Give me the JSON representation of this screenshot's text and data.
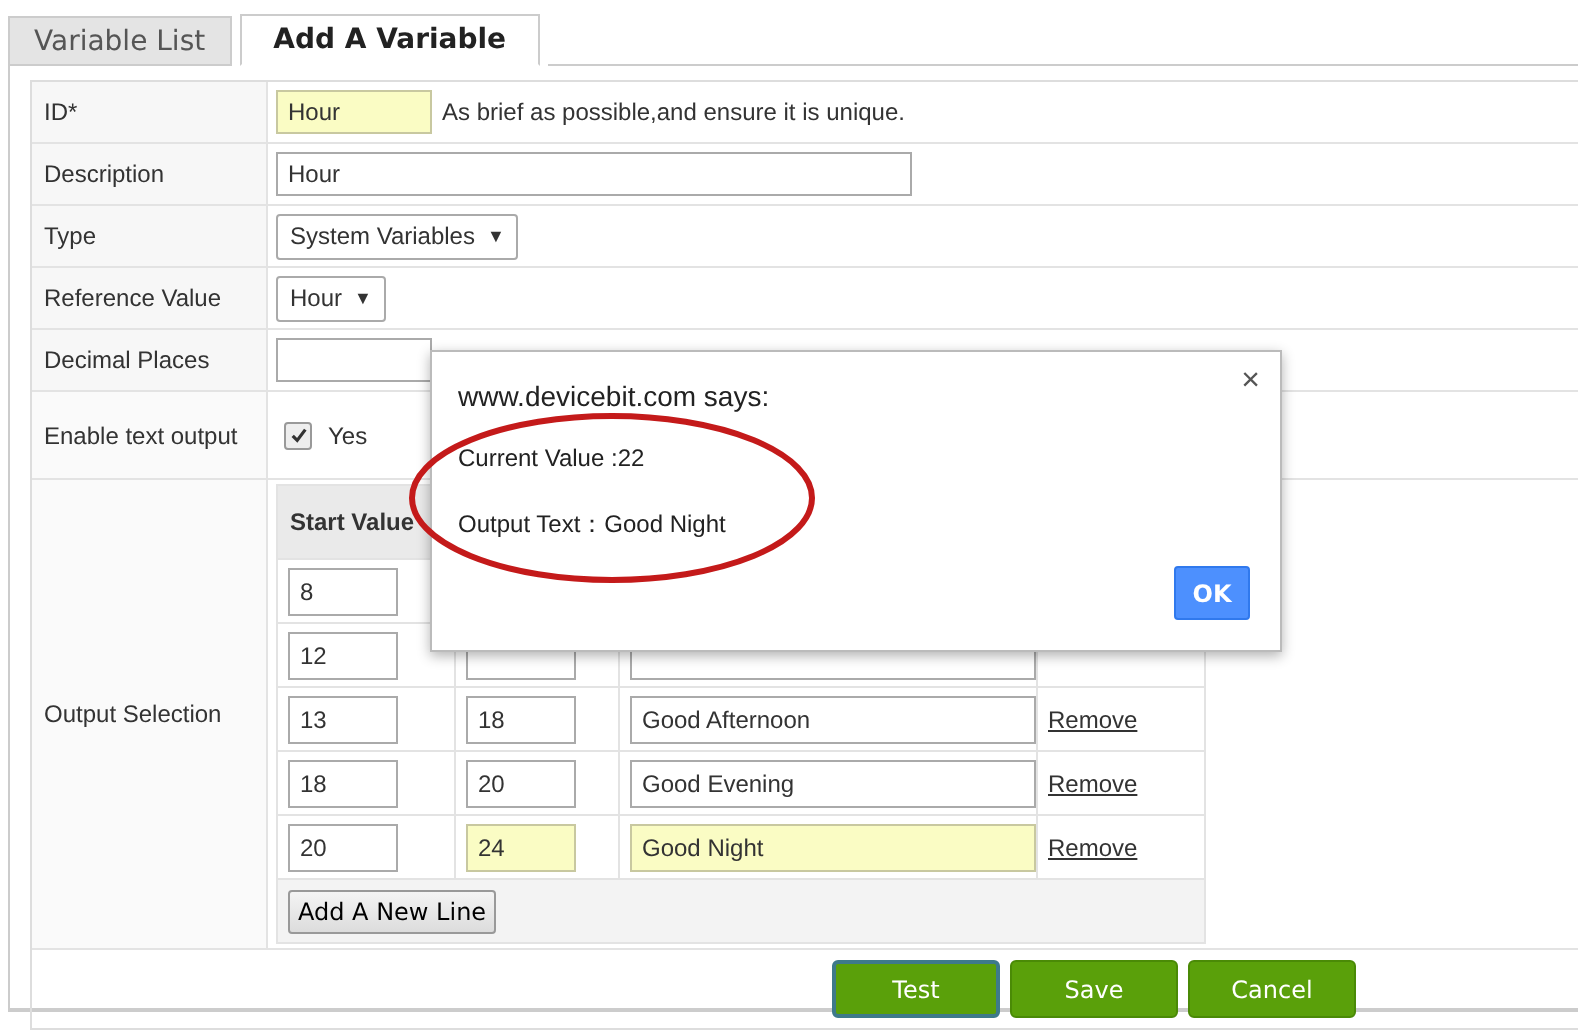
{
  "tabs": [
    {
      "label": "Variable List",
      "selected": false
    },
    {
      "label": "Add A Variable",
      "selected": true
    }
  ],
  "form": [
    {
      "kind": "text",
      "label": "ID*",
      "value": "Hour",
      "autofilled": true,
      "hint": "As brief as possible,and ensure it is unique."
    },
    {
      "kind": "wide_text",
      "label": "Description",
      "value": "Hour",
      "autofilled": false
    },
    {
      "kind": "select",
      "label": "Type",
      "value": "System Variables",
      "caret": "▼"
    },
    {
      "kind": "select",
      "label": "Reference Value",
      "value": "Hour",
      "caret": "▼"
    },
    {
      "kind": "text",
      "label": "Decimal Places",
      "autofilled": false
    },
    {
      "kind": "checkbox",
      "label": "Enable text output",
      "checked": true,
      "option": "Yes"
    },
    {
      "kind": "outputs",
      "label": "Output Selection"
    }
  ],
  "outputs": {
    "header": "Start Value",
    "rows": [
      {
        "start": "8"
      },
      {
        "start": "12"
      },
      {
        "start": "13",
        "end": "18",
        "text": "Good Afternoon",
        "remove": "Remove",
        "autofilled": false
      },
      {
        "start": "18",
        "end": "20",
        "text": "Good Evening",
        "remove": "Remove",
        "autofilled": false
      },
      {
        "start": "20",
        "end": "24",
        "text": "Good Night",
        "remove": "Remove",
        "autofilled": true
      }
    ],
    "add_button": "Add A New Line"
  },
  "buttons": [
    {
      "label": "Test",
      "focused": true
    },
    {
      "label": "Save",
      "focused": false
    },
    {
      "label": "Cancel",
      "focused": false
    }
  ],
  "dialog": {
    "title": "www.devicebit.com says:",
    "close": "×",
    "lines": [
      "Current Value :22",
      "Output Text：Good Night"
    ],
    "button": "OK"
  }
}
